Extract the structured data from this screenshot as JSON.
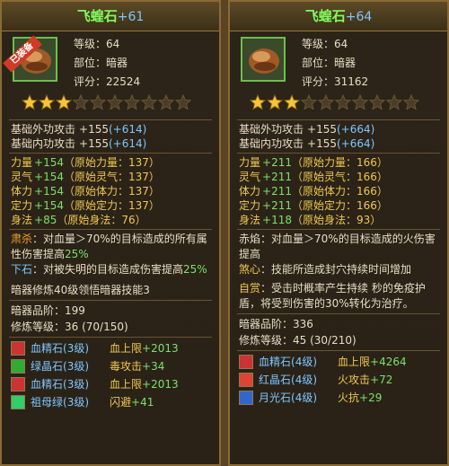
{
  "left": {
    "name": "飞蝗石",
    "plus": "+61",
    "badge": "已装备",
    "level_label": "等级：",
    "level": "64",
    "slot_label": "部位：",
    "slot": "暗器",
    "score_label": "评分：",
    "score": "22524",
    "stars_filled": 3,
    "stars_total": 10,
    "base": [
      {
        "label": "基础外功攻击",
        "value": "+155",
        "bonus": "(+614)"
      },
      {
        "label": "基础内功攻击",
        "value": "+155",
        "bonus": "(+614)"
      }
    ],
    "attrs": [
      {
        "label": "力量",
        "value": "+154",
        "orig": "（原始力量：137）"
      },
      {
        "label": "灵气",
        "value": "+154",
        "orig": "（原始灵气：137）"
      },
      {
        "label": "体力",
        "value": "+154",
        "orig": "（原始体力：137）"
      },
      {
        "label": "定力",
        "value": "+154",
        "orig": "（原始定力：137）"
      },
      {
        "label": "身法",
        "value": "+85",
        "orig": "（原始身法：76）"
      }
    ],
    "skill1_name": "肃杀",
    "skill1_text": "：对血量＞70%的目标造成的所有属性伤害提高",
    "skill1_pct": "25%",
    "skill2_name": "下石",
    "skill2_text": "：对被失明的目标造成伤害提高",
    "skill2_pct": "25%",
    "mastery": "暗器修炼40级领悟暗器技能3",
    "grade_label": "暗器品阶：",
    "grade": "199",
    "train_label": "修炼等级：",
    "train": "36  (70/150)",
    "gems": [
      {
        "name": "血精石",
        "lv": "(3级)",
        "stat": "血上限",
        "val": "+2013",
        "color": "#c33"
      },
      {
        "name": "绿晶石",
        "lv": "(3级)",
        "stat": "毒攻击",
        "val": "+34",
        "color": "#3a3"
      },
      {
        "name": "血精石",
        "lv": "(3级)",
        "stat": "血上限",
        "val": "+2013",
        "color": "#c33"
      },
      {
        "name": "祖母绿",
        "lv": "(3级)",
        "stat": "闪避",
        "val": "+41",
        "color": "#3c6"
      }
    ]
  },
  "right": {
    "name": "飞蝗石",
    "plus": "+64",
    "level_label": "等级：",
    "level": "64",
    "slot_label": "部位：",
    "slot": "暗器",
    "score_label": "评分：",
    "score": "31162",
    "stars_filled": 3,
    "stars_total": 10,
    "base": [
      {
        "label": "基础外功攻击",
        "value": "+155",
        "bonus": "(+664)"
      },
      {
        "label": "基础内功攻击",
        "value": "+155",
        "bonus": "(+664)"
      }
    ],
    "attrs": [
      {
        "label": "力量",
        "value": "+211",
        "orig": "（原始力量：166）"
      },
      {
        "label": "灵气",
        "value": "+211",
        "orig": "（原始灵气：166）"
      },
      {
        "label": "体力",
        "value": "+211",
        "orig": "（原始体力：166）"
      },
      {
        "label": "定力",
        "value": "+211",
        "orig": "（原始定力：166）"
      },
      {
        "label": "身法",
        "value": "+118",
        "orig": "（原始身法：93）"
      }
    ],
    "skill1_name": "赤焰",
    "skill1_text": "：对血量＞70%的目标造成的火伤害提高",
    "skill1_pct": "",
    "skill2_name": "煞心",
    "skill2_text": "：技能所造成封穴持续时间增加",
    "skill2_pct": "",
    "skill3_name": "自赏",
    "skill3_text": "：受击时概率产生持续  秒的免疫护盾，将受到伤害的30%转化为治疗。",
    "grade_label": "暗器品阶：",
    "grade": "336",
    "train_label": "修炼等级：",
    "train": "45  (30/210)",
    "gems": [
      {
        "name": "血精石",
        "lv": "(4级)",
        "stat": "血上限",
        "val": "+4264",
        "color": "#c33"
      },
      {
        "name": "红晶石",
        "lv": "(4级)",
        "stat": "火攻击",
        "val": "+72",
        "color": "#d43"
      },
      {
        "name": "月光石",
        "lv": "(4级)",
        "stat": "火抗",
        "val": "+29",
        "color": "#36c"
      }
    ]
  }
}
